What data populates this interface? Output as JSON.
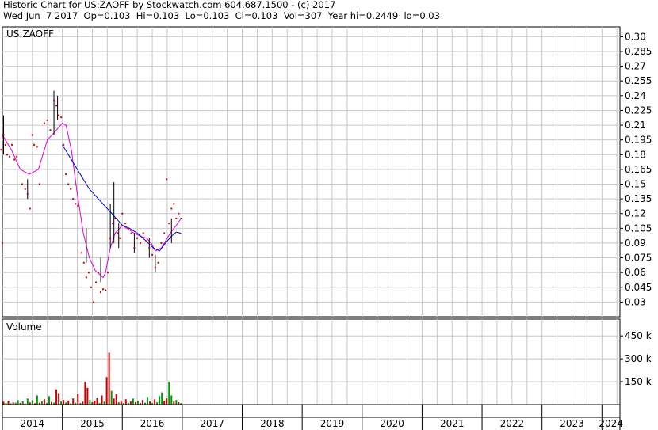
{
  "header": {
    "line1": "Historic Chart for US:ZAOFF by Stockwatch.com 604.687.1500 - (c) 2017",
    "line2": "Wed Jun  7 2017  Op=0.103  Hi=0.103  Lo=0.103  Cl=0.103  Vol=307  Year hi=0.2449  lo=0.03"
  },
  "chart_data": [
    {
      "type": "candlestick",
      "title": "US:ZAOFF",
      "ylim": [
        0.015,
        0.31
      ],
      "y_ticks": [
        "0.30",
        "0.285",
        "0.27",
        "0.255",
        "0.24",
        "0.225",
        "0.21",
        "0.195",
        "0.18",
        "0.165",
        "0.15",
        "0.135",
        "0.12",
        "0.105",
        "0.09",
        "0.075",
        "0.06",
        "0.045",
        "0.03"
      ],
      "xlim": [
        2014.0,
        2024.3
      ],
      "x_ticks": [
        "2014",
        "2015",
        "2016",
        "2017",
        "2018",
        "2019",
        "2020",
        "2021",
        "2022",
        "2023",
        "2024"
      ],
      "grid": true,
      "colors": {
        "price": "#cc0000",
        "wick": "#000000",
        "ma_short": "#dd00dd",
        "ma_long": "#0000cc",
        "grid": "#c8c8c8"
      },
      "price_points": [
        [
          2013.98,
          0.185
        ],
        [
          2014.0,
          0.09
        ],
        [
          2014.02,
          0.2
        ],
        [
          2014.05,
          0.19
        ],
        [
          2014.08,
          0.18
        ],
        [
          2014.12,
          0.178
        ],
        [
          2014.16,
          0.19
        ],
        [
          2014.2,
          0.175
        ],
        [
          2014.24,
          0.178
        ],
        [
          2014.33,
          0.15
        ],
        [
          2014.38,
          0.145
        ],
        [
          2014.42,
          0.14
        ],
        [
          2014.46,
          0.125
        ],
        [
          2014.5,
          0.2
        ],
        [
          2014.53,
          0.19
        ],
        [
          2014.58,
          0.188
        ],
        [
          2014.62,
          0.15
        ],
        [
          2014.7,
          0.212
        ],
        [
          2014.75,
          0.215
        ],
        [
          2014.8,
          0.205
        ],
        [
          2014.86,
          0.235
        ],
        [
          2014.9,
          0.23
        ],
        [
          2014.94,
          0.22
        ],
        [
          2014.98,
          0.218
        ],
        [
          2015.02,
          0.19
        ],
        [
          2015.06,
          0.16
        ],
        [
          2015.1,
          0.15
        ],
        [
          2015.14,
          0.145
        ],
        [
          2015.18,
          0.135
        ],
        [
          2015.22,
          0.13
        ],
        [
          2015.26,
          0.128
        ],
        [
          2015.32,
          0.08
        ],
        [
          2015.36,
          0.07
        ],
        [
          2015.4,
          0.055
        ],
        [
          2015.44,
          0.06
        ],
        [
          2015.48,
          0.045
        ],
        [
          2015.52,
          0.03
        ],
        [
          2015.56,
          0.05
        ],
        [
          2015.6,
          0.06
        ],
        [
          2015.64,
          0.04
        ],
        [
          2015.68,
          0.043
        ],
        [
          2015.72,
          0.042
        ],
        [
          2015.76,
          0.06
        ],
        [
          2015.8,
          0.095
        ],
        [
          2015.84,
          0.11
        ],
        [
          2015.88,
          0.115
        ],
        [
          2015.92,
          0.1
        ],
        [
          2015.96,
          0.095
        ],
        [
          2016.0,
          0.12
        ],
        [
          2016.05,
          0.11
        ],
        [
          2016.1,
          0.105
        ],
        [
          2016.15,
          0.1
        ],
        [
          2016.2,
          0.085
        ],
        [
          2016.25,
          0.095
        ],
        [
          2016.3,
          0.09
        ],
        [
          2016.35,
          0.1
        ],
        [
          2016.4,
          0.092
        ],
        [
          2016.45,
          0.085
        ],
        [
          2016.5,
          0.078
        ],
        [
          2016.55,
          0.065
        ],
        [
          2016.6,
          0.07
        ],
        [
          2016.65,
          0.09
        ],
        [
          2016.7,
          0.1
        ],
        [
          2016.74,
          0.155
        ],
        [
          2016.78,
          0.11
        ],
        [
          2016.82,
          0.125
        ],
        [
          2016.86,
          0.13
        ],
        [
          2016.9,
          0.115
        ],
        [
          2016.94,
          0.12
        ],
        [
          2016.98,
          0.115
        ]
      ],
      "wicks": [
        [
          2014.02,
          0.18,
          0.22
        ],
        [
          2014.42,
          0.135,
          0.155
        ],
        [
          2014.86,
          0.2,
          0.245
        ],
        [
          2014.92,
          0.215,
          0.24
        ],
        [
          2015.4,
          0.07,
          0.105
        ],
        [
          2015.64,
          0.05,
          0.075
        ],
        [
          2015.8,
          0.085,
          0.13
        ],
        [
          2015.86,
          0.09,
          0.152
        ],
        [
          2015.94,
          0.085,
          0.11
        ],
        [
          2016.2,
          0.08,
          0.1
        ],
        [
          2016.45,
          0.075,
          0.095
        ],
        [
          2016.55,
          0.06,
          0.078
        ],
        [
          2016.82,
          0.09,
          0.115
        ]
      ],
      "ma_short": [
        [
          2014.0,
          0.2
        ],
        [
          2014.15,
          0.185
        ],
        [
          2014.3,
          0.165
        ],
        [
          2014.45,
          0.16
        ],
        [
          2014.6,
          0.165
        ],
        [
          2014.75,
          0.195
        ],
        [
          2014.9,
          0.205
        ],
        [
          2015.0,
          0.212
        ],
        [
          2015.06,
          0.21
        ],
        [
          2015.15,
          0.185
        ],
        [
          2015.25,
          0.14
        ],
        [
          2015.35,
          0.1
        ],
        [
          2015.45,
          0.075
        ],
        [
          2015.55,
          0.062
        ],
        [
          2015.68,
          0.055
        ],
        [
          2015.72,
          0.06
        ],
        [
          2015.8,
          0.085
        ],
        [
          2015.88,
          0.1
        ],
        [
          2016.0,
          0.108
        ],
        [
          2016.1,
          0.104
        ],
        [
          2016.2,
          0.1
        ],
        [
          2016.3,
          0.097
        ],
        [
          2016.4,
          0.095
        ],
        [
          2016.48,
          0.09
        ],
        [
          2016.55,
          0.082
        ],
        [
          2016.65,
          0.085
        ],
        [
          2016.72,
          0.092
        ],
        [
          2016.8,
          0.1
        ],
        [
          2016.9,
          0.108
        ],
        [
          2016.98,
          0.115
        ]
      ],
      "ma_long": [
        [
          2015.0,
          0.19
        ],
        [
          2015.15,
          0.175
        ],
        [
          2015.3,
          0.16
        ],
        [
          2015.45,
          0.145
        ],
        [
          2015.6,
          0.135
        ],
        [
          2015.75,
          0.125
        ],
        [
          2015.9,
          0.115
        ],
        [
          2016.0,
          0.108
        ],
        [
          2016.12,
          0.105
        ],
        [
          2016.25,
          0.1
        ],
        [
          2016.4,
          0.092
        ],
        [
          2016.52,
          0.085
        ],
        [
          2016.62,
          0.082
        ],
        [
          2016.72,
          0.09
        ],
        [
          2016.82,
          0.097
        ],
        [
          2016.9,
          0.101
        ],
        [
          2016.98,
          0.1
        ]
      ]
    },
    {
      "type": "bar",
      "title": "Volume",
      "ylim": [
        0,
        560
      ],
      "y_ticks": [
        "450 k",
        "300 k",
        "150 k"
      ],
      "y_units": "k",
      "colors": {
        "up": "#009900",
        "down": "#cc0000"
      },
      "bars": [
        [
          2014.02,
          18,
          "down"
        ],
        [
          2014.06,
          10,
          "up"
        ],
        [
          2014.1,
          25,
          "down"
        ],
        [
          2014.14,
          8,
          "up"
        ],
        [
          2014.18,
          15,
          "down"
        ],
        [
          2014.22,
          12,
          "up"
        ],
        [
          2014.26,
          30,
          "up"
        ],
        [
          2014.3,
          10,
          "down"
        ],
        [
          2014.34,
          22,
          "up"
        ],
        [
          2014.38,
          6,
          "down"
        ],
        [
          2014.42,
          40,
          "up"
        ],
        [
          2014.46,
          14,
          "down"
        ],
        [
          2014.5,
          28,
          "up"
        ],
        [
          2014.54,
          9,
          "down"
        ],
        [
          2014.58,
          60,
          "up"
        ],
        [
          2014.62,
          12,
          "down"
        ],
        [
          2014.66,
          20,
          "up"
        ],
        [
          2014.7,
          35,
          "down"
        ],
        [
          2014.74,
          10,
          "up"
        ],
        [
          2014.78,
          55,
          "up"
        ],
        [
          2014.82,
          18,
          "down"
        ],
        [
          2014.86,
          12,
          "up"
        ],
        [
          2014.9,
          100,
          "down"
        ],
        [
          2014.94,
          75,
          "down"
        ],
        [
          2014.98,
          20,
          "up"
        ],
        [
          2015.02,
          30,
          "down"
        ],
        [
          2015.06,
          14,
          "up"
        ],
        [
          2015.1,
          25,
          "down"
        ],
        [
          2015.14,
          8,
          "up"
        ],
        [
          2015.18,
          40,
          "down"
        ],
        [
          2015.22,
          12,
          "up"
        ],
        [
          2015.26,
          70,
          "down"
        ],
        [
          2015.3,
          10,
          "up"
        ],
        [
          2015.34,
          20,
          "down"
        ],
        [
          2015.38,
          150,
          "down"
        ],
        [
          2015.42,
          110,
          "down"
        ],
        [
          2015.46,
          30,
          "up"
        ],
        [
          2015.5,
          15,
          "down"
        ],
        [
          2015.54,
          25,
          "down"
        ],
        [
          2015.58,
          45,
          "down"
        ],
        [
          2015.62,
          10,
          "up"
        ],
        [
          2015.66,
          60,
          "down"
        ],
        [
          2015.7,
          20,
          "up"
        ],
        [
          2015.74,
          180,
          "down"
        ],
        [
          2015.78,
          340,
          "down"
        ],
        [
          2015.82,
          90,
          "up"
        ],
        [
          2015.86,
          40,
          "down"
        ],
        [
          2015.9,
          70,
          "down"
        ],
        [
          2015.94,
          15,
          "up"
        ],
        [
          2015.98,
          25,
          "down"
        ],
        [
          2016.02,
          10,
          "up"
        ],
        [
          2016.06,
          35,
          "down"
        ],
        [
          2016.1,
          12,
          "up"
        ],
        [
          2016.14,
          20,
          "down"
        ],
        [
          2016.18,
          40,
          "up"
        ],
        [
          2016.22,
          15,
          "down"
        ],
        [
          2016.26,
          25,
          "up"
        ],
        [
          2016.3,
          10,
          "down"
        ],
        [
          2016.34,
          30,
          "down"
        ],
        [
          2016.38,
          12,
          "up"
        ],
        [
          2016.42,
          50,
          "up"
        ],
        [
          2016.46,
          20,
          "down"
        ],
        [
          2016.5,
          10,
          "up"
        ],
        [
          2016.54,
          35,
          "down"
        ],
        [
          2016.58,
          15,
          "up"
        ],
        [
          2016.62,
          55,
          "up"
        ],
        [
          2016.66,
          80,
          "up"
        ],
        [
          2016.7,
          25,
          "down"
        ],
        [
          2016.74,
          40,
          "down"
        ],
        [
          2016.78,
          150,
          "up"
        ],
        [
          2016.82,
          60,
          "up"
        ],
        [
          2016.86,
          20,
          "down"
        ],
        [
          2016.9,
          30,
          "up"
        ],
        [
          2016.94,
          15,
          "down"
        ],
        [
          2016.98,
          10,
          "up"
        ]
      ]
    }
  ]
}
